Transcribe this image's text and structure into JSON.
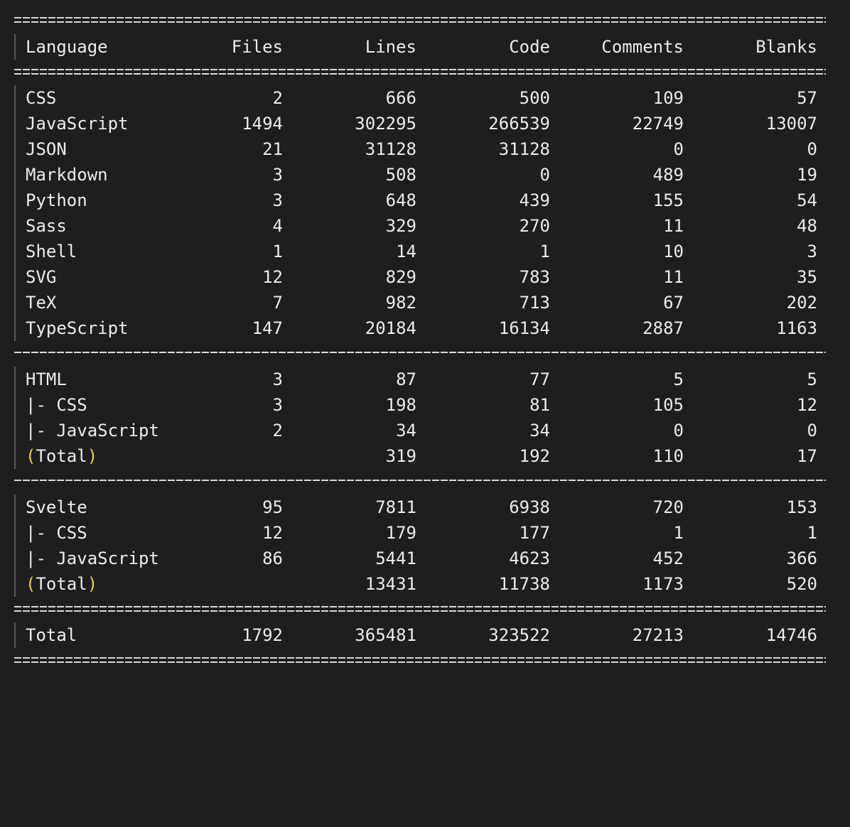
{
  "header": {
    "language": "Language",
    "files": "Files",
    "lines": "Lines",
    "code": "Code",
    "comments": "Comments",
    "blanks": "Blanks"
  },
  "main_rows": [
    {
      "language": "CSS",
      "files": "2",
      "lines": "666",
      "code": "500",
      "comments": "109",
      "blanks": "57"
    },
    {
      "language": "JavaScript",
      "files": "1494",
      "lines": "302295",
      "code": "266539",
      "comments": "22749",
      "blanks": "13007"
    },
    {
      "language": "JSON",
      "files": "21",
      "lines": "31128",
      "code": "31128",
      "comments": "0",
      "blanks": "0"
    },
    {
      "language": "Markdown",
      "files": "3",
      "lines": "508",
      "code": "0",
      "comments": "489",
      "blanks": "19"
    },
    {
      "language": "Python",
      "files": "3",
      "lines": "648",
      "code": "439",
      "comments": "155",
      "blanks": "54"
    },
    {
      "language": "Sass",
      "files": "4",
      "lines": "329",
      "code": "270",
      "comments": "11",
      "blanks": "48"
    },
    {
      "language": "Shell",
      "files": "1",
      "lines": "14",
      "code": "1",
      "comments": "10",
      "blanks": "3"
    },
    {
      "language": "SVG",
      "files": "12",
      "lines": "829",
      "code": "783",
      "comments": "11",
      "blanks": "35"
    },
    {
      "language": "TeX",
      "files": "7",
      "lines": "982",
      "code": "713",
      "comments": "67",
      "blanks": "202"
    },
    {
      "language": "TypeScript",
      "files": "147",
      "lines": "20184",
      "code": "16134",
      "comments": "2887",
      "blanks": "1163"
    }
  ],
  "html_group": {
    "rows": [
      {
        "language": "HTML",
        "files": "3",
        "lines": "87",
        "code": "77",
        "comments": "5",
        "blanks": "5"
      },
      {
        "language": "|- CSS",
        "files": "3",
        "lines": "198",
        "code": "81",
        "comments": "105",
        "blanks": "12"
      },
      {
        "language": "|- JavaScript",
        "files": "2",
        "lines": "34",
        "code": "34",
        "comments": "0",
        "blanks": "0"
      }
    ],
    "total": {
      "open": "(",
      "label": "Total",
      "close": ")",
      "lines": "319",
      "code": "192",
      "comments": "110",
      "blanks": "17"
    }
  },
  "svelte_group": {
    "rows": [
      {
        "language": "Svelte",
        "files": "95",
        "lines": "7811",
        "code": "6938",
        "comments": "720",
        "blanks": "153"
      },
      {
        "language": "|- CSS",
        "files": "12",
        "lines": "179",
        "code": "177",
        "comments": "1",
        "blanks": "1"
      },
      {
        "language": "|- JavaScript",
        "files": "86",
        "lines": "5441",
        "code": "4623",
        "comments": "452",
        "blanks": "366"
      }
    ],
    "total": {
      "open": "(",
      "label": "Total",
      "close": ")",
      "lines": "13431",
      "code": "11738",
      "comments": "1173",
      "blanks": "520"
    }
  },
  "grand_total": {
    "language": "Total",
    "files": "1792",
    "lines": "365481",
    "code": "323522",
    "comments": "27213",
    "blanks": "14746"
  },
  "colors": {
    "background": "#1e1e1e",
    "text": "#ececec",
    "paren_accent": "#f2c94c"
  }
}
